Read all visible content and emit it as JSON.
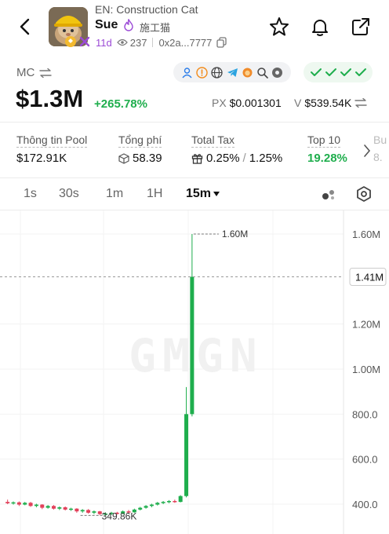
{
  "header": {
    "subtitle": "EN: Construction Cat",
    "token_name": "Sue",
    "token_name_cn": "施工猫",
    "age": "11d",
    "views": "237",
    "address": "0x2a...7777"
  },
  "market": {
    "mc_label": "MC",
    "mc_value": "$1.3M",
    "mc_change": "+265.78%",
    "price_label": "PX",
    "price_value": "$0.001301",
    "volume_label": "V",
    "volume_value": "$539.54K"
  },
  "stats": {
    "pool_label": "Thông tin Pool",
    "pool_value": "$172.91K",
    "fees_label": "Tổng phí",
    "fees_value": "58.39",
    "tax_label": "Total Tax",
    "tax_buy": "0.25%",
    "tax_sep": "/",
    "tax_sell": "1.25%",
    "top10_label": "Top 10",
    "top10_value": "19.28%",
    "next_label_partial": "Bu",
    "next_value_partial": "8."
  },
  "timeframes": [
    "1s",
    "30s",
    "1m",
    "1H",
    "15m"
  ],
  "active_timeframe": "15m",
  "colors": {
    "up": "#1fae4d",
    "down": "#e2405a",
    "accent_purple": "#9b4ad6"
  },
  "chart_data": {
    "type": "candlestick",
    "watermark": "GMGN",
    "y_ticks": [
      "1.60M",
      "1.20M",
      "1.00M",
      "800.0",
      "600.0",
      "400.0"
    ],
    "y_tick_values": [
      1600000,
      1200000,
      1000000,
      800000,
      600000,
      400000
    ],
    "ylim": [
      330000,
      1700000
    ],
    "current_price_label": "1.41M",
    "current_price": 1410000,
    "high_label": "1.60M",
    "high_value": 1600000,
    "low_label": "349.86K",
    "low_value": 349860,
    "candles": [
      {
        "o": 410000,
        "h": 420000,
        "l": 400000,
        "c": 404000
      },
      {
        "o": 404000,
        "h": 412000,
        "l": 398000,
        "c": 408000
      },
      {
        "o": 408000,
        "h": 412000,
        "l": 392000,
        "c": 398000
      },
      {
        "o": 398000,
        "h": 410000,
        "l": 395000,
        "c": 406000
      },
      {
        "o": 406000,
        "h": 410000,
        "l": 388000,
        "c": 392000
      },
      {
        "o": 392000,
        "h": 402000,
        "l": 386000,
        "c": 398000
      },
      {
        "o": 398000,
        "h": 400000,
        "l": 378000,
        "c": 384000
      },
      {
        "o": 384000,
        "h": 396000,
        "l": 380000,
        "c": 392000
      },
      {
        "o": 392000,
        "h": 396000,
        "l": 376000,
        "c": 380000
      },
      {
        "o": 380000,
        "h": 390000,
        "l": 374000,
        "c": 386000
      },
      {
        "o": 386000,
        "h": 390000,
        "l": 372000,
        "c": 376000
      },
      {
        "o": 376000,
        "h": 384000,
        "l": 370000,
        "c": 380000
      },
      {
        "o": 380000,
        "h": 382000,
        "l": 362000,
        "c": 368000
      },
      {
        "o": 368000,
        "h": 378000,
        "l": 362000,
        "c": 374000
      },
      {
        "o": 374000,
        "h": 378000,
        "l": 358000,
        "c": 362000
      },
      {
        "o": 362000,
        "h": 372000,
        "l": 356000,
        "c": 368000
      },
      {
        "o": 368000,
        "h": 370000,
        "l": 352000,
        "c": 356000
      },
      {
        "o": 356000,
        "h": 364000,
        "l": 349860,
        "c": 358000
      },
      {
        "o": 358000,
        "h": 366000,
        "l": 352000,
        "c": 362000
      },
      {
        "o": 362000,
        "h": 366000,
        "l": 354000,
        "c": 358000
      },
      {
        "o": 358000,
        "h": 372000,
        "l": 355000,
        "c": 368000
      },
      {
        "o": 368000,
        "h": 374000,
        "l": 360000,
        "c": 364000
      },
      {
        "o": 364000,
        "h": 380000,
        "l": 362000,
        "c": 376000
      },
      {
        "o": 376000,
        "h": 388000,
        "l": 372000,
        "c": 384000
      },
      {
        "o": 384000,
        "h": 396000,
        "l": 380000,
        "c": 392000
      },
      {
        "o": 392000,
        "h": 402000,
        "l": 386000,
        "c": 398000
      },
      {
        "o": 398000,
        "h": 410000,
        "l": 394000,
        "c": 406000
      },
      {
        "o": 406000,
        "h": 414000,
        "l": 400000,
        "c": 410000
      },
      {
        "o": 410000,
        "h": 418000,
        "l": 404000,
        "c": 414000
      },
      {
        "o": 414000,
        "h": 420000,
        "l": 406000,
        "c": 410000
      },
      {
        "o": 410000,
        "h": 440000,
        "l": 408000,
        "c": 436000
      },
      {
        "o": 436000,
        "h": 920000,
        "l": 430000,
        "c": 800000
      },
      {
        "o": 800000,
        "h": 1600000,
        "l": 790000,
        "c": 1410000
      }
    ]
  }
}
